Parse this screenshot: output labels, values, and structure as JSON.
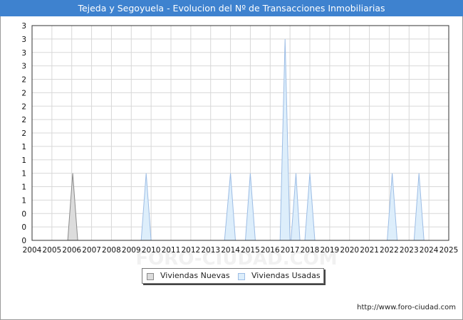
{
  "window": {
    "title": "Tejeda y Segoyuela - Evolucion del Nº de Transacciones Inmobiliarias",
    "footer_url": "http://www.foro-ciudad.com",
    "watermark": "FORO-CIUDAD.COM"
  },
  "colors": {
    "title_bg": "#3e82cf",
    "nuevas_stroke": "#8a8a8a",
    "nuevas_fill": "#dcdcdc",
    "usadas_stroke": "#9dbde5",
    "usadas_fill": "#ddeefb",
    "grid": "#d8d8d8"
  },
  "chart_data": {
    "type": "area",
    "title": "Tejeda y Segoyuela - Evolucion del Nº de Transacciones Inmobiliarias",
    "xlabel": "",
    "ylabel": "",
    "xlim": [
      2004,
      2025
    ],
    "ylim": [
      0,
      3.2
    ],
    "x_tick_labels": [
      "2004",
      "2005",
      "2006",
      "2007",
      "2008",
      "2009",
      "2010",
      "2011",
      "2012",
      "2013",
      "2014",
      "2015",
      "2016",
      "2017",
      "2018",
      "2019",
      "2020",
      "2021",
      "2022",
      "2023",
      "2024",
      "2025"
    ],
    "y_tick_labels": [
      "0",
      "0",
      "0",
      "1",
      "1",
      "1",
      "1",
      "1",
      "2",
      "2",
      "2",
      "2",
      "2",
      "3",
      "3",
      "3",
      "3"
    ],
    "grid": true,
    "legend_position": "bottom-center",
    "series": [
      {
        "name": "Viviendas Nuevas",
        "points": [
          [
            2005.8,
            0
          ],
          [
            2006.05,
            1
          ],
          [
            2006.3,
            0
          ]
        ]
      },
      {
        "name": "Viviendas Usadas",
        "points": [
          [
            2009.5,
            0
          ],
          [
            2009.75,
            1
          ],
          [
            2010.0,
            0
          ],
          [
            2013.7,
            0
          ],
          [
            2014.0,
            1
          ],
          [
            2014.25,
            0
          ],
          [
            2014.75,
            0
          ],
          [
            2015.0,
            1
          ],
          [
            2015.25,
            0
          ],
          [
            2016.5,
            0
          ],
          [
            2016.75,
            3
          ],
          [
            2017.0,
            0
          ],
          [
            2017.05,
            0
          ],
          [
            2017.3,
            1
          ],
          [
            2017.5,
            0
          ],
          [
            2017.75,
            0
          ],
          [
            2018.0,
            1
          ],
          [
            2018.25,
            0
          ],
          [
            2021.9,
            0
          ],
          [
            2022.15,
            1
          ],
          [
            2022.4,
            0
          ],
          [
            2023.25,
            0
          ],
          [
            2023.5,
            1
          ],
          [
            2023.75,
            0
          ]
        ]
      }
    ]
  }
}
